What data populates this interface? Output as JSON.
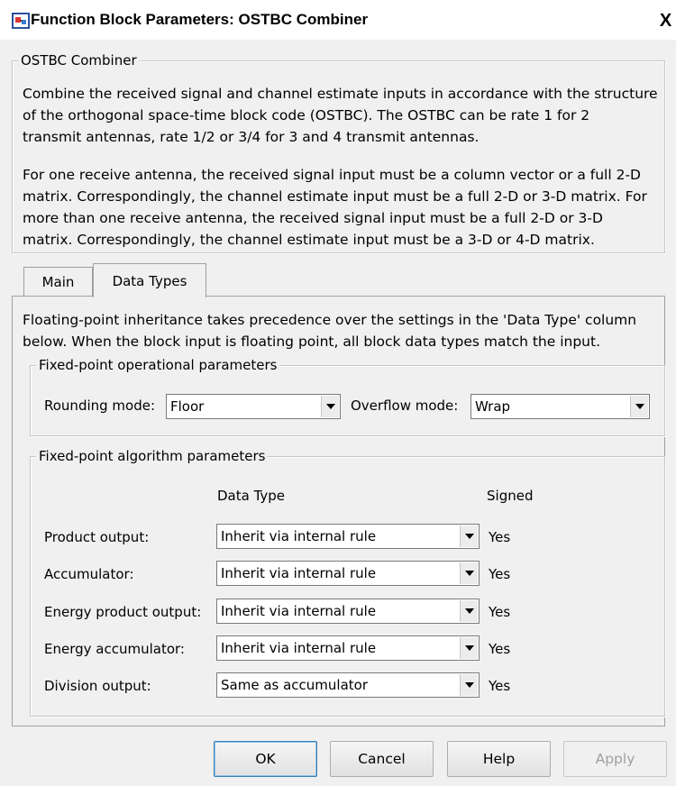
{
  "window": {
    "title": "Function Block Parameters: OSTBC Combiner",
    "close_label": "X",
    "icon": "simulink-block-icon"
  },
  "description": {
    "group_title": "OSTBC Combiner",
    "lines": [
      "Combine the received signal and channel estimate inputs in accordance with the structure",
      "of the orthogonal space-time block code (OSTBC). The OSTBC can be rate 1 for 2",
      "transmit antennas, rate 1/2 or 3/4 for 3 and 4 transmit antennas.",
      "",
      "For one receive antenna, the received signal input must be a column vector or a full 2-D",
      "matrix. Correspondingly, the channel estimate input must be a full 2-D or 3-D matrix. For",
      "more than one receive antenna, the received signal input must be a full 2-D or 3-D",
      "matrix. Correspondingly, the channel estimate input must be a 3-D or 4-D matrix."
    ]
  },
  "tabs": [
    {
      "label": "Main",
      "active": false
    },
    {
      "label": "Data Types",
      "active": true
    }
  ],
  "data_types_tab": {
    "note_lines": [
      "Floating-point inheritance takes precedence over the settings in the 'Data Type' column",
      "below. When the block input is floating point, all block data types match the input."
    ],
    "operational": {
      "group_title": "Fixed-point operational parameters",
      "rounding_label": "Rounding mode:",
      "rounding_value": "Floor",
      "overflow_label": "Overflow mode:",
      "overflow_value": "Wrap"
    },
    "algorithm": {
      "group_title": "Fixed-point algorithm parameters",
      "col_data_type": "Data Type",
      "col_signed": "Signed",
      "rows": [
        {
          "label": "Product output:",
          "data_type": "Inherit via internal rule",
          "signed": "Yes"
        },
        {
          "label": "Accumulator:",
          "data_type": "Inherit via internal rule",
          "signed": "Yes"
        },
        {
          "label": "Energy product output:",
          "data_type": "Inherit via internal rule",
          "signed": "Yes"
        },
        {
          "label": "Energy accumulator:",
          "data_type": "Inherit via internal rule",
          "signed": "Yes"
        },
        {
          "label": "Division output:",
          "data_type": "Same as accumulator",
          "signed": "Yes"
        }
      ]
    }
  },
  "buttons": {
    "ok": "OK",
    "cancel": "Cancel",
    "help": "Help",
    "apply": "Apply",
    "apply_enabled": false
  },
  "colors": {
    "window_bg": "#f0f0f0",
    "titlebar_bg": "#ffffff",
    "default_button_border": "#3c7fb1",
    "disabled_text": "#a0a0a0"
  }
}
